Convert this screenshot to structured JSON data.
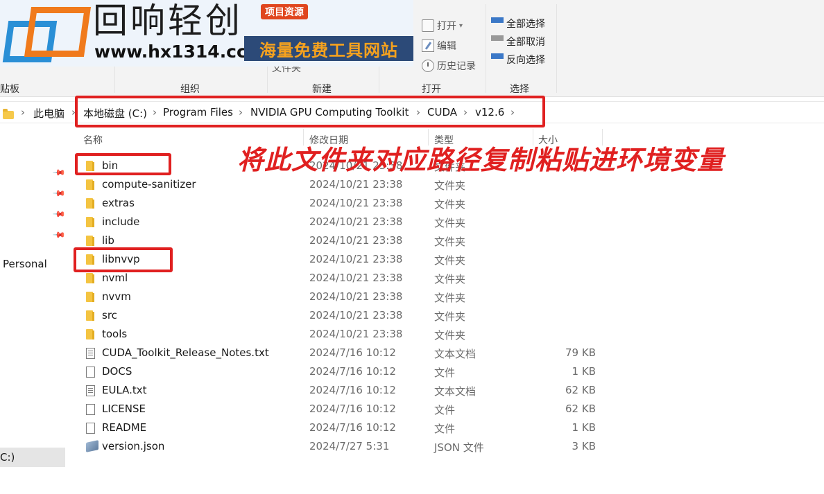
{
  "ribbon": {
    "clipboard_label": "剪贴板",
    "organize_label": "组织",
    "new_label": "新建",
    "new_folder_fragment": "文件夹",
    "open_label": "打开",
    "select_label": "选择",
    "open_btn": "打开",
    "edit_btn": "编辑",
    "history_btn": "历史记录",
    "select_all_btn": "全部选择",
    "select_none_btn": "全部取消",
    "invert_btn": "反向选择"
  },
  "watermark": {
    "brand": "回响轻创",
    "url": "www.hx1314.cc",
    "badge": "项目资源",
    "slogan": "海量免费工具网站"
  },
  "address": {
    "crumbs": [
      "此电脑",
      "本地磁盘 (C:)",
      "Program Files",
      "NVIDIA GPU Computing Toolkit",
      "CUDA",
      "v12.6"
    ]
  },
  "nav": {
    "personal": "Personal",
    "drive": "C:)"
  },
  "columns": {
    "name": "名称",
    "date": "修改日期",
    "type": "类型",
    "size": "大小"
  },
  "files": [
    {
      "name": "bin",
      "date": "2024/10/21 23:38",
      "type": "文件夹",
      "size": "",
      "icon": "folder-icon"
    },
    {
      "name": "compute-sanitizer",
      "date": "2024/10/21 23:38",
      "type": "文件夹",
      "size": "",
      "icon": "folder-icon"
    },
    {
      "name": "extras",
      "date": "2024/10/21 23:38",
      "type": "文件夹",
      "size": "",
      "icon": "folder-icon"
    },
    {
      "name": "include",
      "date": "2024/10/21 23:38",
      "type": "文件夹",
      "size": "",
      "icon": "folder-icon"
    },
    {
      "name": "lib",
      "date": "2024/10/21 23:38",
      "type": "文件夹",
      "size": "",
      "icon": "folder-icon"
    },
    {
      "name": "libnvvp",
      "date": "2024/10/21 23:38",
      "type": "文件夹",
      "size": "",
      "icon": "folder-icon"
    },
    {
      "name": "nvml",
      "date": "2024/10/21 23:38",
      "type": "文件夹",
      "size": "",
      "icon": "folder-icon"
    },
    {
      "name": "nvvm",
      "date": "2024/10/21 23:38",
      "type": "文件夹",
      "size": "",
      "icon": "folder-icon"
    },
    {
      "name": "src",
      "date": "2024/10/21 23:38",
      "type": "文件夹",
      "size": "",
      "icon": "folder-icon"
    },
    {
      "name": "tools",
      "date": "2024/10/21 23:38",
      "type": "文件夹",
      "size": "",
      "icon": "folder-icon"
    },
    {
      "name": "CUDA_Toolkit_Release_Notes.txt",
      "date": "2024/7/16 10:12",
      "type": "文本文档",
      "size": "79 KB",
      "icon": "text-file-icon"
    },
    {
      "name": "DOCS",
      "date": "2024/7/16 10:12",
      "type": "文件",
      "size": "1 KB",
      "icon": "file-icon"
    },
    {
      "name": "EULA.txt",
      "date": "2024/7/16 10:12",
      "type": "文本文档",
      "size": "62 KB",
      "icon": "text-file-icon"
    },
    {
      "name": "LICENSE",
      "date": "2024/7/16 10:12",
      "type": "文件",
      "size": "62 KB",
      "icon": "file-icon"
    },
    {
      "name": "README",
      "date": "2024/7/16 10:12",
      "type": "文件",
      "size": "1 KB",
      "icon": "file-icon"
    },
    {
      "name": "version.json",
      "date": "2024/7/27 5:31",
      "type": "JSON 文件",
      "size": "3 KB",
      "icon": "json-file-icon"
    }
  ],
  "annotation": {
    "text": "将此文件夹对应路径复制粘贴进环境变量",
    "color": "#e02020"
  }
}
